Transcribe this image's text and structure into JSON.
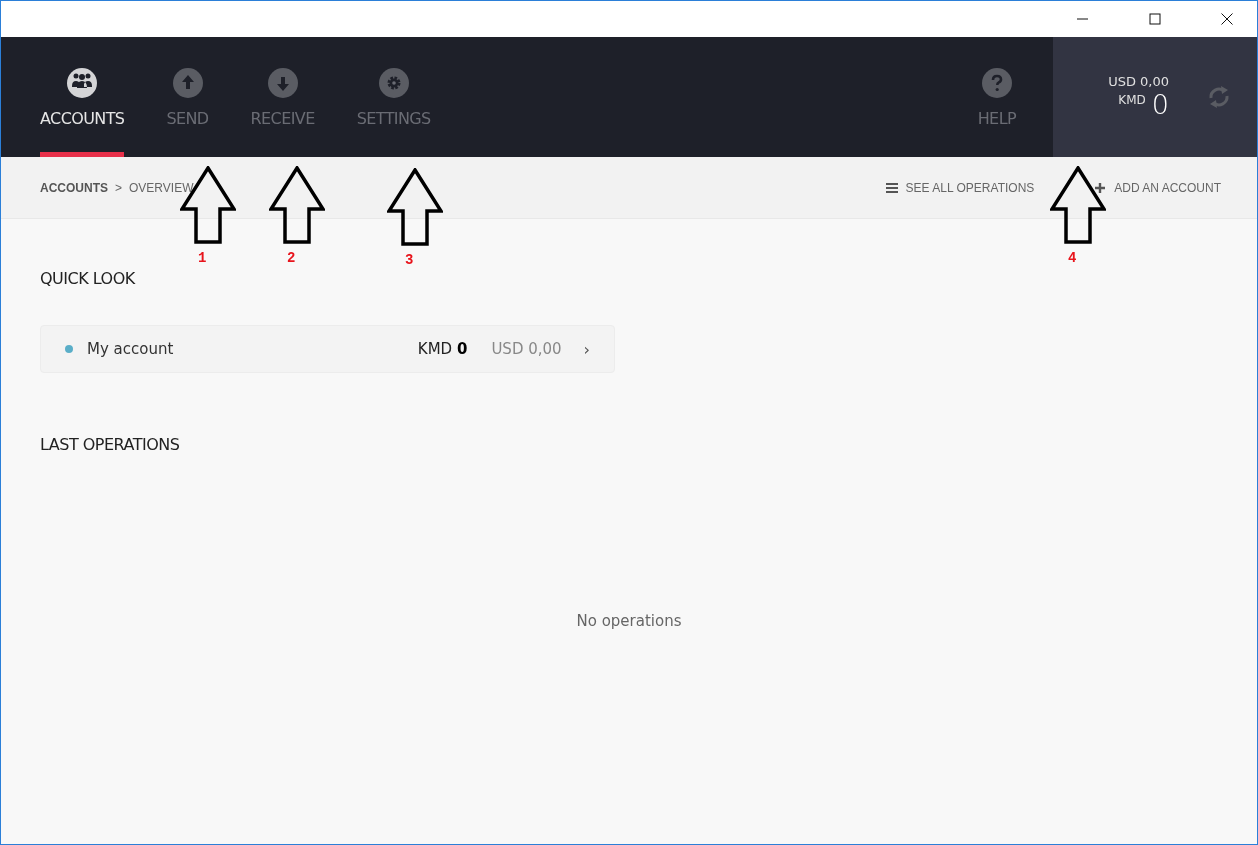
{
  "nav": {
    "tabs": [
      {
        "kind": "accounts",
        "label": "ACCOUNTS",
        "selected": true
      },
      {
        "kind": "send",
        "label": "SEND",
        "selected": false
      },
      {
        "kind": "receive",
        "label": "RECEIVE",
        "selected": false
      },
      {
        "kind": "settings",
        "label": "SETTINGS",
        "selected": false
      }
    ],
    "help": {
      "label": "HELP"
    },
    "balance": {
      "fiat": "USD 0,00",
      "currency": "KMD",
      "amount": "0"
    }
  },
  "breadcrumb": {
    "items": [
      "ACCOUNTS",
      "OVERVIEW"
    ],
    "separator": ">"
  },
  "actions": [
    {
      "kind": "list",
      "label": "SEE ALL OPERATIONS"
    },
    {
      "kind": "add",
      "label": "ADD AN ACCOUNT"
    }
  ],
  "quick_look": {
    "title": "QUICK LOOK",
    "accounts": [
      {
        "name": "My account",
        "color": "#5aaec8",
        "balance": "KMD **0**",
        "fiat": "USD 0,00",
        "chevron": "›"
      }
    ]
  },
  "last_operations": {
    "title": "LAST OPERATIONS",
    "empty": "No operations"
  },
  "annotations": [
    {
      "label": "1"
    },
    {
      "label": "2"
    },
    {
      "label": "3"
    },
    {
      "label": "4"
    }
  ]
}
